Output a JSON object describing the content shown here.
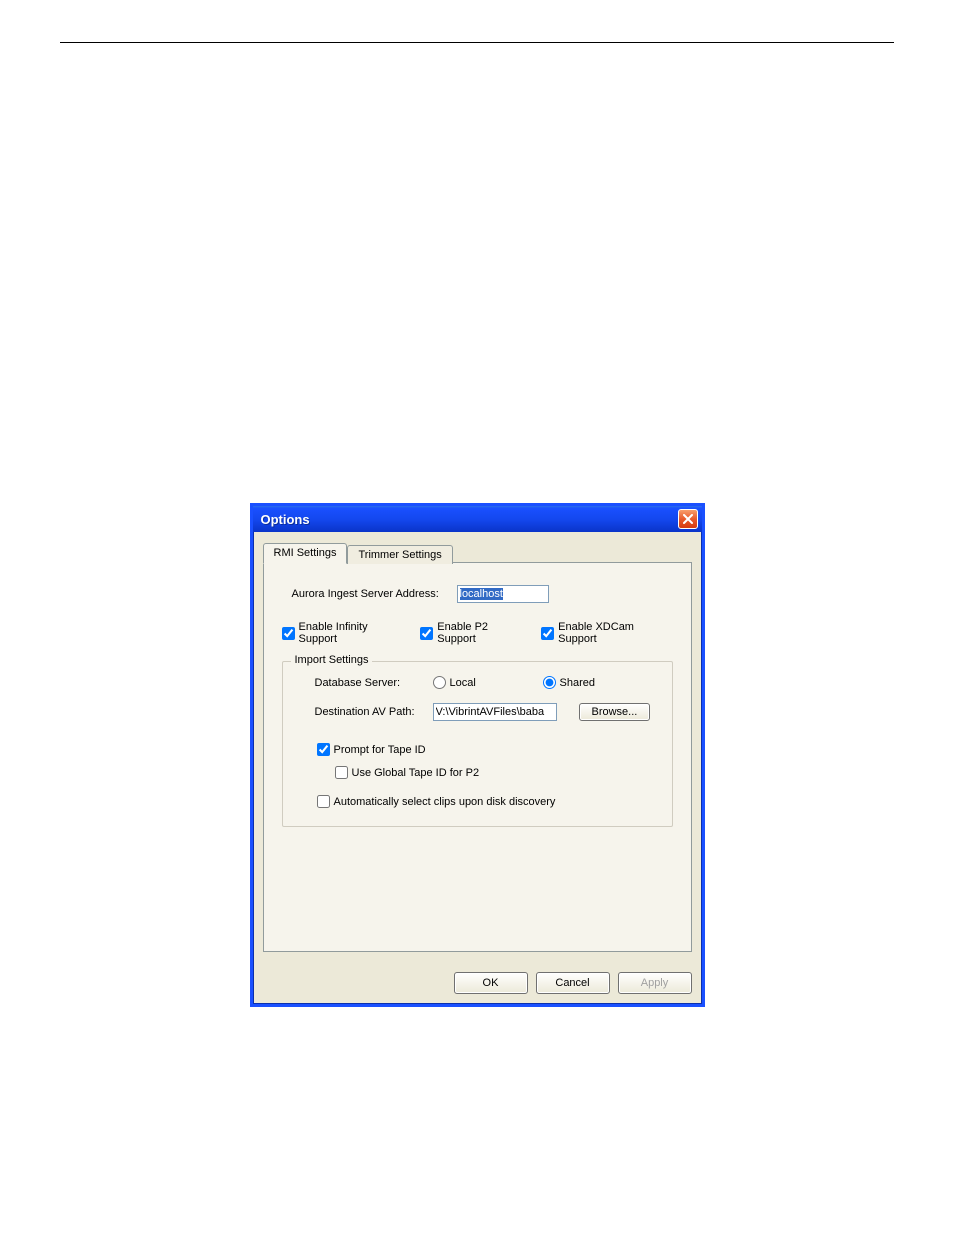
{
  "dialog": {
    "title": "Options",
    "tabs": [
      {
        "label": "RMI Settings",
        "active": true
      },
      {
        "label": "Trimmer Settings",
        "active": false
      }
    ],
    "rmi": {
      "server_address_label": "Aurora Ingest Server Address:",
      "server_address_value": "localhost",
      "enable_infinity": {
        "label": "Enable Infinity Support",
        "checked": true
      },
      "enable_p2": {
        "label": "Enable P2 Support",
        "checked": true
      },
      "enable_xdcam": {
        "label": "Enable XDCam Support",
        "checked": true
      },
      "import": {
        "title": "Import Settings",
        "db_server_label": "Database Server:",
        "db_local_label": "Local",
        "db_shared_label": "Shared",
        "db_selected": "shared",
        "dest_path_label": "Destination AV Path:",
        "dest_path_value": "V:\\VibrintAVFiles\\baba",
        "browse_label": "Browse...",
        "prompt_tape": {
          "label": "Prompt for Tape ID",
          "checked": true
        },
        "global_tape": {
          "label": "Use Global Tape ID for P2",
          "checked": false
        },
        "auto_select": {
          "label": "Automatically select clips upon disk discovery",
          "checked": false
        }
      }
    },
    "buttons": {
      "ok": "OK",
      "cancel": "Cancel",
      "apply": "Apply"
    }
  }
}
